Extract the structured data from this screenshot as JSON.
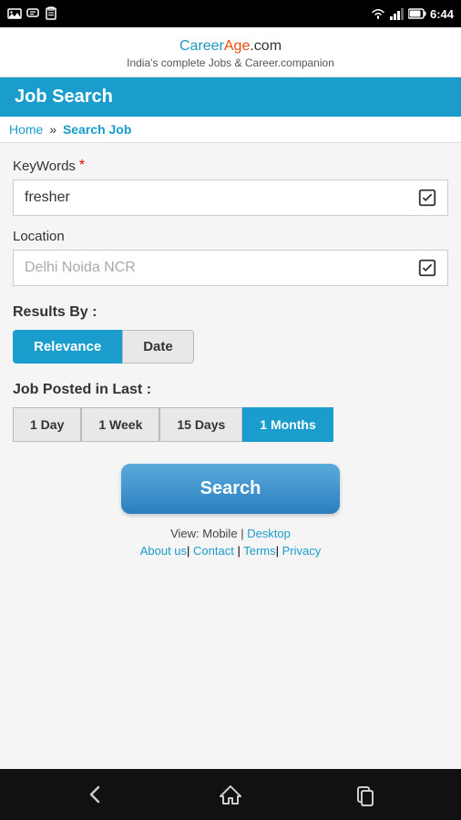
{
  "statusBar": {
    "time": "6:44",
    "icons_left": [
      "gallery-icon",
      "bbm-icon",
      "clipboard-icon"
    ],
    "icons_right": [
      "wifi-icon",
      "signal-icon",
      "battery-icon"
    ]
  },
  "brand": {
    "career": "Career",
    "age": "Age",
    "dotcom": ".com",
    "tagline": "India's complete Jobs & Career.companion"
  },
  "sectionTitle": "Job Search",
  "breadcrumb": {
    "home": "Home",
    "separator": "»",
    "current": "Search Job"
  },
  "form": {
    "keywords_label": "KeyWords",
    "keywords_value": "fresher",
    "location_label": "Location",
    "location_placeholder": "Delhi Noida NCR"
  },
  "resultsBy": {
    "label": "Results By :",
    "options": [
      {
        "label": "Relevance",
        "active": true
      },
      {
        "label": "Date",
        "active": false
      }
    ]
  },
  "postedLast": {
    "label": "Job Posted in Last :",
    "options": [
      {
        "label": "1 Day",
        "active": false
      },
      {
        "label": "1 Week",
        "active": false
      },
      {
        "label": "15 Days",
        "active": false
      },
      {
        "label": "1 Months",
        "active": true
      }
    ]
  },
  "searchBtn": "Search",
  "footer": {
    "view_label": "View: Mobile",
    "desktop_link": "Desktop",
    "about_link": "About us",
    "contact_link": "Contact",
    "terms_link": "Terms",
    "privacy_link": "Privacy"
  }
}
